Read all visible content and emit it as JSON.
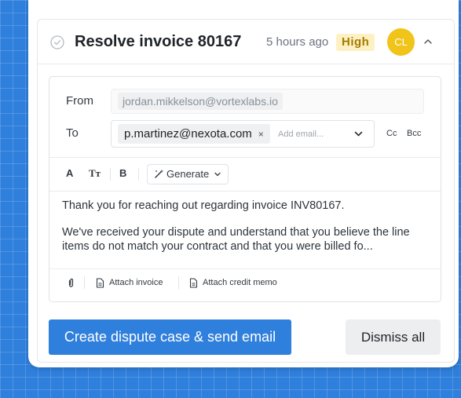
{
  "card": {
    "title": "Resolve invoice 80167",
    "time": "5 hours ago",
    "priority": "High",
    "avatar_initials": "CL"
  },
  "email": {
    "from_label": "From",
    "from_value": "jordan.mikkelson@vortexlabs.io",
    "to_label": "To",
    "to_recipient": "p.martinez@nexota.com",
    "to_remove": "×",
    "to_placeholder": "Add email...",
    "cc_label": "Cc",
    "bcc_label": "Bcc"
  },
  "toolbar": {
    "font": "A",
    "text_size": "Tт",
    "bold": "B",
    "generate_label": "Generate"
  },
  "body": {
    "paragraph1": "Thank you for reaching out regarding invoice INV80167.",
    "paragraph2": "We've received your dispute and understand that you believe the line items do not match your contract and that you were billed fo..."
  },
  "attachments": {
    "attach_invoice": "Attach invoice",
    "attach_credit_memo": "Attach credit memo"
  },
  "actions": {
    "primary": "Create dispute case & send email",
    "secondary": "Dismiss all"
  },
  "colors": {
    "accent": "#2f7fdc",
    "priority_bg": "#fdf1c3",
    "priority_text": "#a67a00",
    "avatar": "#f0c419"
  }
}
